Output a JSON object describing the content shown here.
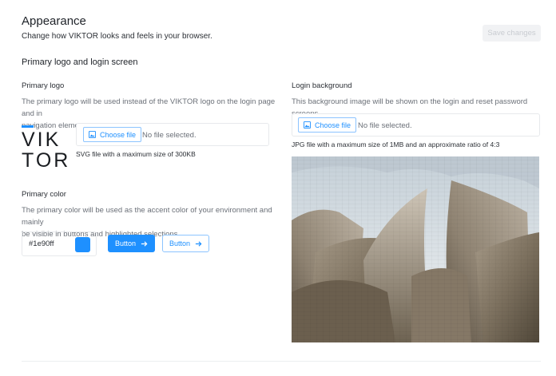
{
  "header": {
    "title": "Appearance",
    "subtitle": "Change how VIKTOR looks and feels in your browser.",
    "save_label": "Save changes"
  },
  "section": {
    "title": "Primary logo and login screen"
  },
  "primary_logo": {
    "label": "Primary logo",
    "description_line1": "The primary logo will be used instead of the VIKTOR logo on the login page and in",
    "description_line2": "navigation elements.",
    "logo_text_top": "VIK",
    "logo_text_bottom": "TOR",
    "choose_label": "Choose file",
    "no_file": "No file selected.",
    "hint": "SVG file with a maximum size of 300KB"
  },
  "primary_color": {
    "label": "Primary color",
    "description_line1": "The primary color will be used as the accent color of your environment and mainly",
    "description_line2": "be visible in buttons and highlighted selections.",
    "value": "#1e90ff",
    "swatch_color": "#1e90ff",
    "button_filled_label": "Button",
    "button_outline_label": "Button"
  },
  "login_background": {
    "label": "Login background",
    "description": "This background image will be shown on the login and reset password screens.",
    "choose_label": "Choose file",
    "no_file": "No file selected.",
    "hint": "JPG file with a maximum size of 1MB and an approximate ratio of 4:3"
  },
  "colors": {
    "accent": "#1e90ff",
    "text": "#20242a",
    "muted": "#6b7078"
  }
}
